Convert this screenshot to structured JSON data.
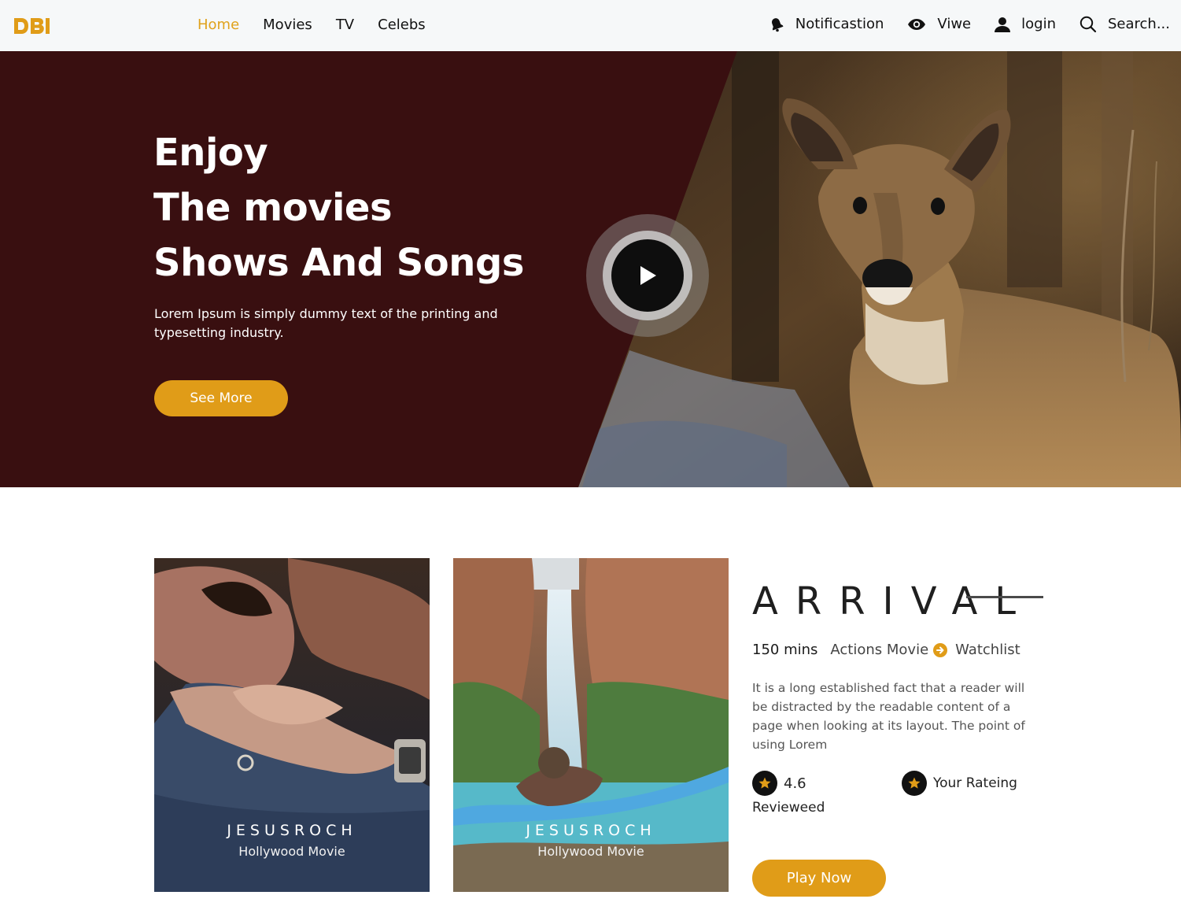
{
  "brand": {
    "logo": "DBI",
    "accent": "#e09c18"
  },
  "nav": {
    "items": [
      {
        "label": "Home",
        "active": true
      },
      {
        "label": "Movies",
        "active": false
      },
      {
        "label": "TV",
        "active": false
      },
      {
        "label": "Celebs",
        "active": false
      }
    ],
    "notification": {
      "label": "Notificastion",
      "icon": "bell-icon"
    },
    "view": {
      "label": "Viwe",
      "icon": "eye-icon"
    },
    "login": {
      "label": "login",
      "icon": "user-icon"
    },
    "search": {
      "label": "Search...",
      "icon": "search-icon"
    }
  },
  "hero": {
    "title_lines": [
      "Enjoy",
      "The movies",
      "Shows And Songs"
    ],
    "description": "Lorem Ipsum is simply dummy text of the printing and typesetting industry.",
    "button": "See More",
    "background": "#390f10"
  },
  "cards": [
    {
      "name": "JESUSROCH",
      "subtitle": "Hollywood Movie"
    },
    {
      "name": "JESUSROCH",
      "subtitle": "Hollywood Movie"
    }
  ],
  "movie": {
    "title": "ARRIVAL",
    "duration": "150 mins",
    "genre": "Actions Movie",
    "watchlist": "Watchlist",
    "description": "It is a long established fact that a reader will be distracted by the readable content of a page when looking at its layout. The point of using Lorem",
    "rating": "4.6",
    "your_rating_label": "Your Rateing",
    "reviewed_label": "Revieweed",
    "play_button": "Play Now"
  }
}
